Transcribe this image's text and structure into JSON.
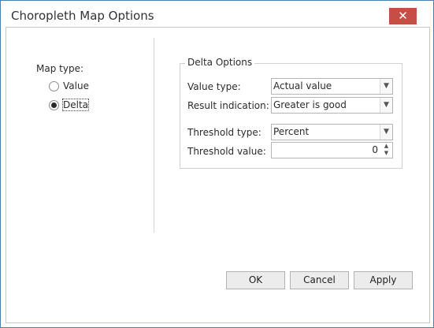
{
  "window": {
    "title": "Choropleth Map Options",
    "close_glyph": "✕"
  },
  "map_type": {
    "label": "Map type:",
    "options": [
      {
        "label": "Value",
        "checked": false
      },
      {
        "label": "Delta",
        "checked": true
      }
    ]
  },
  "delta_options": {
    "title": "Delta Options",
    "value_type": {
      "label": "Value type:",
      "value": "Actual value"
    },
    "result_indication": {
      "label": "Result indication:",
      "value": "Greater is good"
    },
    "threshold_type": {
      "label": "Threshold type:",
      "value": "Percent"
    },
    "threshold_value": {
      "label": "Threshold value:",
      "value": "0"
    }
  },
  "buttons": {
    "ok": "OK",
    "cancel": "Cancel",
    "apply": "Apply"
  },
  "icons": {
    "dropdown": "chevron-down-icon",
    "spin": "spin-arrows-icon"
  },
  "colors": {
    "close": "#c74e45",
    "border": "#4a7fb0"
  }
}
